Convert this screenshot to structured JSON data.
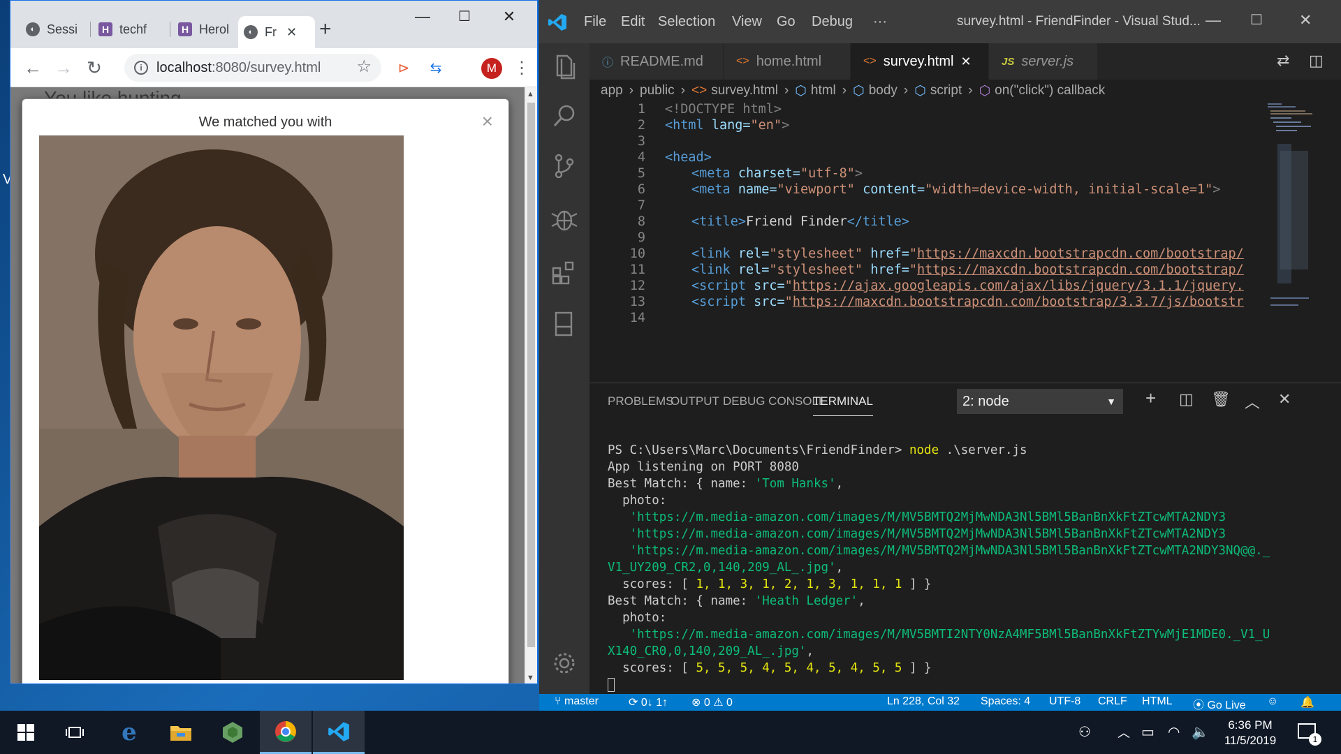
{
  "chrome": {
    "tabs": [
      {
        "label": "Sessi",
        "icon": "globe-icon"
      },
      {
        "label": "techf",
        "icon": "heroku-icon"
      },
      {
        "label": "Herol",
        "icon": "heroku-icon"
      },
      {
        "label": "Fr",
        "icon": "globe-icon",
        "active": true
      }
    ],
    "url_host": "localhost",
    "url_path": ":8080/survey.html",
    "avatar_letter": "M",
    "page_background_text": "You like hunting",
    "modal": {
      "title": "We matched you with",
      "close": "×"
    }
  },
  "desktop": {
    "left_edge_text": "V"
  },
  "vscode": {
    "menu": [
      "File",
      "Edit",
      "Selection",
      "View",
      "Go",
      "Debug",
      "···"
    ],
    "window_title": "survey.html - FriendFinder - Visual Stud...",
    "tabs": [
      {
        "label": "README.md",
        "icon": "ⓘ"
      },
      {
        "label": "home.html",
        "icon": "<>"
      },
      {
        "label": "survey.html",
        "icon": "<>",
        "active": true
      },
      {
        "label": "server.js",
        "icon": "JS"
      }
    ],
    "breadcrumb": [
      "app",
      "public",
      "survey.html",
      "html",
      "body",
      "script",
      "on(\"click\") callback"
    ],
    "code_lines": [
      {
        "n": "1"
      },
      {
        "n": "2"
      },
      {
        "n": "3"
      },
      {
        "n": "4"
      },
      {
        "n": "5"
      },
      {
        "n": "6"
      },
      {
        "n": "7"
      },
      {
        "n": "8"
      },
      {
        "n": "9"
      },
      {
        "n": "10"
      },
      {
        "n": "11"
      },
      {
        "n": "12"
      },
      {
        "n": "13"
      },
      {
        "n": "14"
      }
    ],
    "code": {
      "l1": "<!DOCTYPE html>",
      "l2a": "<html ",
      "l2b": "lang=",
      "l2c": "\"en\"",
      "l2d": ">",
      "l4": "<head>",
      "l5a": "<meta ",
      "l5b": "charset=",
      "l5c": "\"utf-8\"",
      "l5d": ">",
      "l6a": "<meta ",
      "l6b": "name=",
      "l6c": "\"viewport\" ",
      "l6d": "content=",
      "l6e": "\"width=device-width, initial-scale=1\"",
      "l6f": ">",
      "l8a": "<title>",
      "l8b": "Friend Finder",
      "l8c": "</title>",
      "l10a": "<link ",
      "l10b": "rel=",
      "l10c": "\"stylesheet\" ",
      "l10d": "href=",
      "l10e": "\"",
      "l10f": "https://maxcdn.bootstrapcdn.com/bootstrap/",
      "l11a": "<link ",
      "l11b": "rel=",
      "l11c": "\"stylesheet\" ",
      "l11d": "href=",
      "l11e": "\"",
      "l11f": "https://maxcdn.bootstrapcdn.com/bootstrap/",
      "l12a": "<script ",
      "l12b": "src=",
      "l12c": "\"",
      "l12d": "https://ajax.googleapis.com/ajax/libs/jquery/3.1.1/jquery.",
      "l13a": "<script ",
      "l13b": "src=",
      "l13c": "\"",
      "l13d": "https://maxcdn.bootstrapcdn.com/bootstrap/3.3.7/js/bootstr"
    },
    "panel_tabs": [
      "PROBLEMS",
      "OUTPUT",
      "DEBUG CONSOLE",
      "TERMINAL"
    ],
    "terminal_select": "2: node",
    "terminal": {
      "prompt": "PS C:\\Users\\Marc\\Documents\\FriendFinder> ",
      "cmd": "node",
      "cmd_arg": " .\\server.js",
      "l2": "App listening on PORT 8080",
      "l3a": "Best Match: { name: ",
      "l3b": "'Tom Hanks'",
      "l3c": ",",
      "l4": "  photo:",
      "l5": "   'https://m.media-amazon.com/images/M/MV5BMTQ2MjMwNDA3Nl5BMl5BanBnXkFtZTcwMTA2NDY3",
      "l6": "   'https://m.media-amazon.com/images/M/MV5BMTQ2MjMwNDA3Nl5BMl5BanBnXkFtZTcwMTA2NDY3",
      "l7": "   'https://m.media-amazon.com/images/M/MV5BMTQ2MjMwNDA3Nl5BMl5BanBnXkFtZTcwMTA2NDY3NQ@@._",
      "l8a": "V1_UY209_CR2,0,140,209_AL_.jpg'",
      "l8b": ",",
      "l9a": "  scores: [ ",
      "l9b": "1, 1, 3, 1, 2, 1, 3, 1, 1, 1",
      "l9c": " ] }",
      "l10a": "Best Match: { name: ",
      "l10b": "'Heath Ledger'",
      "l10c": ",",
      "l11": "  photo:",
      "l12": "   'https://m.media-amazon.com/images/M/MV5BMTI2NTY0NzA4MF5BMl5BanBnXkFtZTYwMjE1MDE0._V1_U",
      "l13a": "X140_CR0,0,140,209_AL_.jpg'",
      "l13b": ",",
      "l14a": "  scores: [ ",
      "l14b": "5, 5, 5, 4, 5, 4, 5, 4, 5, 5",
      "l14c": " ] }"
    },
    "status": {
      "branch": "master",
      "sync": "0↓ 1↑",
      "problems": "⊗ 0 ⚠ 0",
      "position": "Ln 228, Col 32",
      "spaces": "Spaces: 4",
      "encoding": "UTF-8",
      "eol": "CRLF",
      "language": "HTML",
      "golive": "Go Live"
    }
  },
  "taskbar": {
    "time": "6:36 PM",
    "date": "11/5/2019",
    "notifications": "1"
  },
  "colors": {
    "vscode_status": "#007acc",
    "chrome_avatar": "#c5221f",
    "taskbar": "#101826"
  }
}
